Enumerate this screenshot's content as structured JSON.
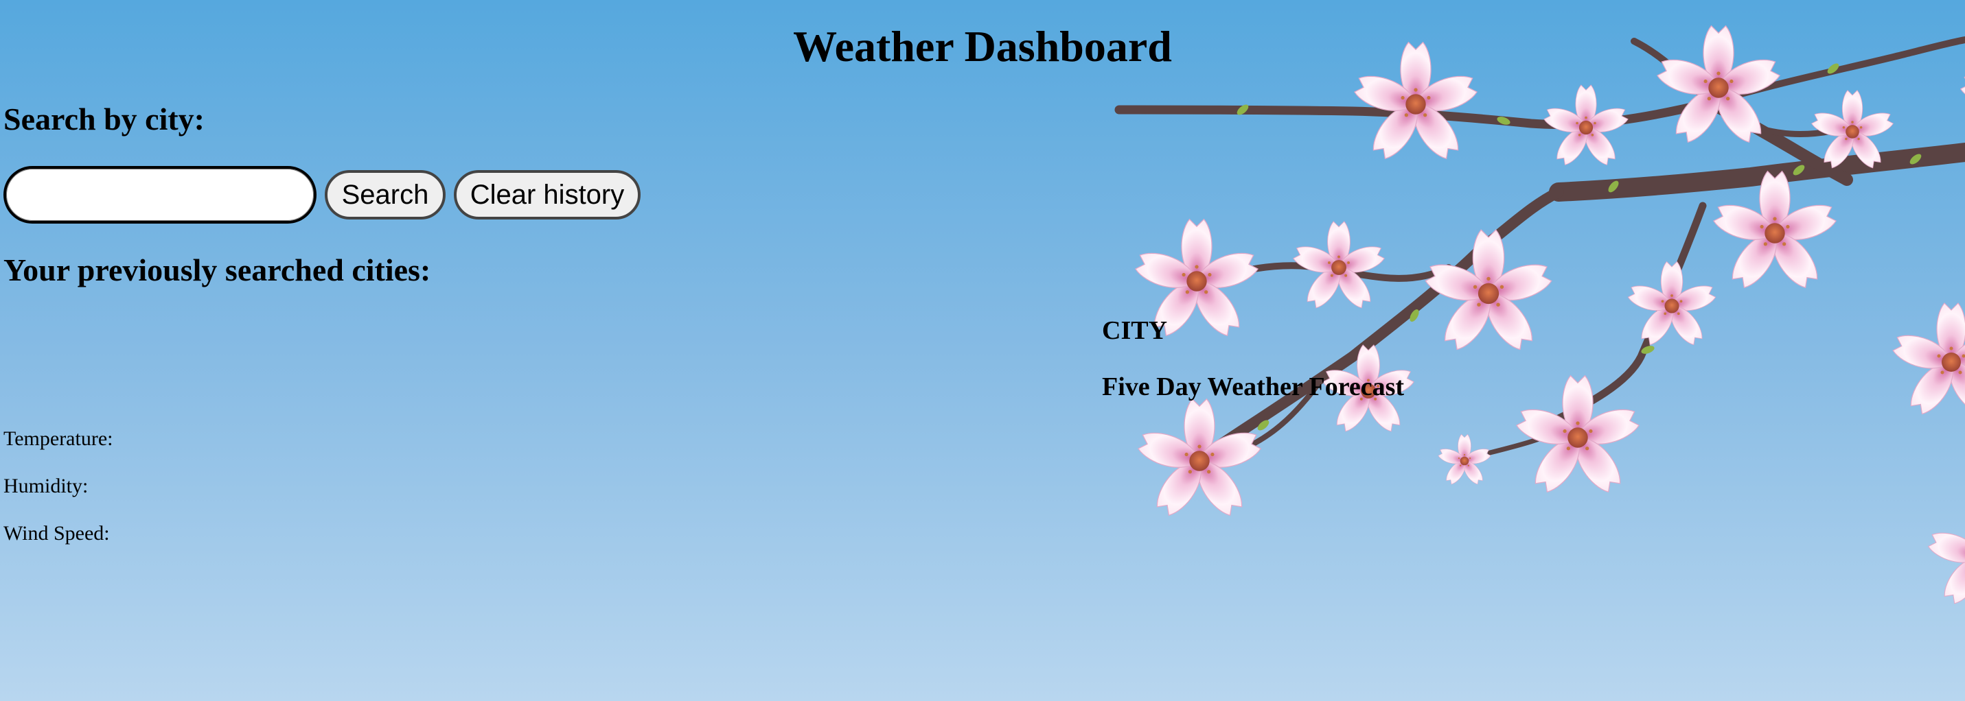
{
  "header": {
    "title": "Weather Dashboard"
  },
  "search": {
    "heading": "Search by city:",
    "input_value": "",
    "input_placeholder": "",
    "search_label": "Search",
    "clear_label": "Clear history"
  },
  "history": {
    "heading": "Your previously searched cities:",
    "cities": []
  },
  "conditions": {
    "temperature_label": "Temperature:",
    "humidity_label": "Humidity:",
    "wind_label": "Wind Speed:"
  },
  "city": {
    "name": "CITY"
  },
  "forecast": {
    "heading": "Five Day Weather Forecast",
    "days": []
  },
  "colors": {
    "sky_top": "#56a8de",
    "sky_bottom": "#b8d6ef",
    "branch": "#5a4343",
    "petal": "#fbe6f1",
    "petal_edge": "#d98ab5",
    "blossom_center": "#b6573f"
  },
  "decoration": {
    "background_icon": "cherry-blossom-branch"
  }
}
